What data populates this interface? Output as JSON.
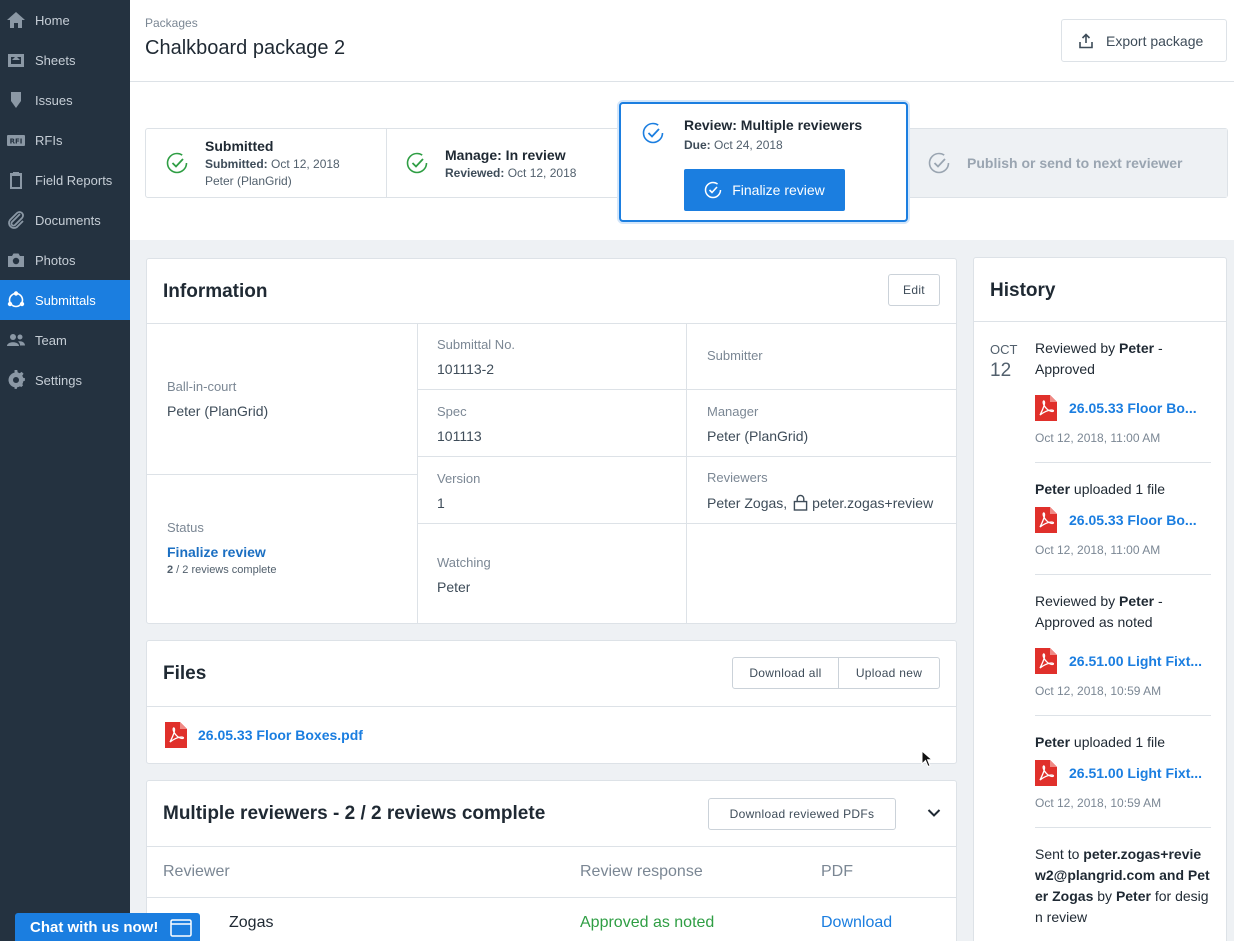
{
  "sidebar": {
    "items": [
      {
        "label": "Home",
        "icon": "home-icon"
      },
      {
        "label": "Sheets",
        "icon": "sheets-icon"
      },
      {
        "label": "Issues",
        "icon": "issues-icon"
      },
      {
        "label": "RFIs",
        "icon": "rfi-icon"
      },
      {
        "label": "Field Reports",
        "icon": "clipboard-icon"
      },
      {
        "label": "Documents",
        "icon": "paperclip-icon"
      },
      {
        "label": "Photos",
        "icon": "camera-icon"
      },
      {
        "label": "Submittals",
        "icon": "submittals-icon"
      },
      {
        "label": "Team",
        "icon": "team-icon"
      },
      {
        "label": "Settings",
        "icon": "gear-icon"
      }
    ],
    "active": "Submittals"
  },
  "header": {
    "breadcrumb": "Packages",
    "title": "Chalkboard package 2",
    "export_label": "Export package"
  },
  "workflow": {
    "step1": {
      "title": "Submitted",
      "detail_label": "Submitted:",
      "detail_value": "Oct 12, 2018",
      "person": "Peter (PlanGrid)"
    },
    "step2": {
      "title": "Manage: In review",
      "detail_label": "Reviewed:",
      "detail_value": "Oct 12, 2018"
    },
    "step3": {
      "title": "Review: Multiple reviewers",
      "detail_label": "Due:",
      "detail_value": "Oct 24, 2018",
      "button": "Finalize review"
    },
    "step4": {
      "title": "Publish or send to next reviewer"
    }
  },
  "information": {
    "title": "Information",
    "edit_label": "Edit",
    "ball_in_court_label": "Ball-in-court",
    "ball_in_court_value": "Peter (PlanGrid)",
    "status_label": "Status",
    "status_value": "Finalize review",
    "status_count": "2",
    "status_rest": " / 2 reviews complete",
    "submittal_no_label": "Submittal No.",
    "submittal_no_value": "101113-2",
    "spec_label": "Spec",
    "spec_value": "101113",
    "version_label": "Version",
    "version_value": "1",
    "watching_label": "Watching",
    "watching_value": "Peter",
    "submitter_label": "Submitter",
    "manager_label": "Manager",
    "manager_value": "Peter (PlanGrid)",
    "reviewers_label": "Reviewers",
    "reviewer1": "Peter Zogas,",
    "reviewer2": "peter.zogas+review"
  },
  "files": {
    "title": "Files",
    "download_all": "Download all",
    "upload_new": "Upload new",
    "items": [
      "26.05.33 Floor Boxes.pdf"
    ]
  },
  "reviewers": {
    "title": "Multiple reviewers - 2 / 2 reviews complete",
    "download_label": "Download reviewed PDFs",
    "col_reviewer": "Reviewer",
    "col_response": "Review response",
    "col_pdf": "PDF",
    "row1_reviewer": "Zogas",
    "row1_response": "Approved as noted",
    "row1_pdf": "Download"
  },
  "history": {
    "title": "History",
    "month": "OCT",
    "day": "12",
    "e1_pre": "Reviewed by ",
    "e1_name": "Peter",
    "e1_post": " - Approved",
    "e1_file": "26.05.33 Floor Bo...",
    "e1_time": "Oct 12, 2018, 11:00 AM",
    "e2_name": "Peter",
    "e2_post": " uploaded 1 file",
    "e2_file": "26.05.33 Floor Bo...",
    "e2_time": "Oct 12, 2018, 11:00 AM",
    "e3_pre": "Reviewed by ",
    "e3_name": "Peter",
    "e3_post": " - Approved as noted",
    "e3_file": "26.51.00 Light Fixt...",
    "e3_time": "Oct 12, 2018, 10:59 AM",
    "e4_name": "Peter",
    "e4_post": " uploaded 1 file",
    "e4_file": "26.51.00 Light Fixt...",
    "e4_time": "Oct 12, 2018, 10:59 AM",
    "e5_pre": "Sent to ",
    "e5_email": "peter.zogas+review2@plangrid.com and Peter Zogas",
    "e5_mid": " by ",
    "e5_name": "Peter",
    "e5_post": " for design review"
  },
  "chat": {
    "label": "Chat with us now!"
  },
  "colors": {
    "accent": "#1b7ee0",
    "sidebar": "#243240",
    "success": "#2f9e44",
    "pdf": "#e0302b"
  }
}
